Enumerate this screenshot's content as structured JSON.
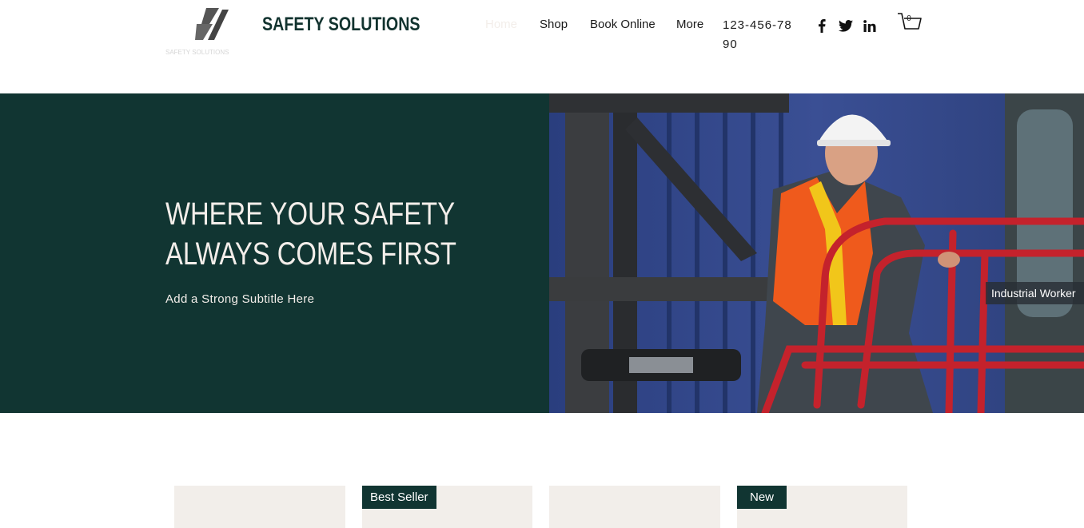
{
  "header": {
    "brand": "SAFETY SOLUTIONS",
    "logo_tagline": "SAFETY SOLUTIONS",
    "nav": [
      {
        "label": "Home"
      },
      {
        "label": "Shop"
      },
      {
        "label": "Book Online"
      },
      {
        "label": "More"
      }
    ],
    "phone": "123-456-7890",
    "social": [
      "facebook-icon",
      "twitter-icon",
      "linkedin-icon"
    ],
    "cart_count": "0"
  },
  "hero": {
    "title": "WHERE YOUR SAFETY ALWAYS COMES FIRST",
    "subtitle": "Add a Strong Subtitle Here",
    "image_caption": "Industrial Worker"
  },
  "products": [
    {
      "ribbon": ""
    },
    {
      "ribbon": "Best Seller"
    },
    {
      "ribbon": ""
    },
    {
      "ribbon": "New"
    }
  ],
  "colors": {
    "brand_dark": "#113532",
    "cream": "#f3eeea",
    "card_bg": "#f2eeea"
  }
}
